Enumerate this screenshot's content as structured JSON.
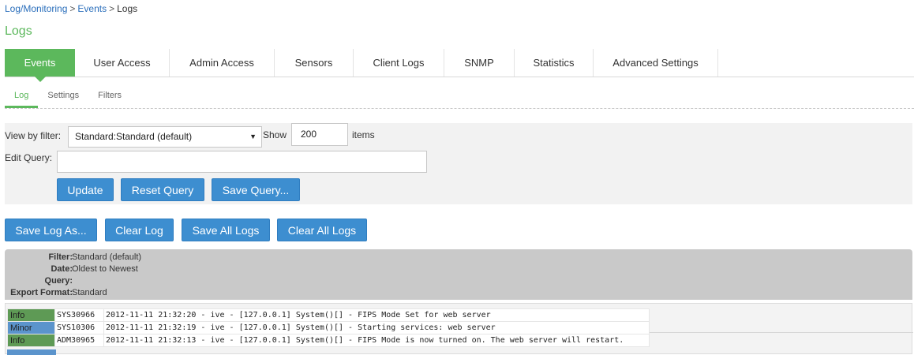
{
  "breadcrumb": {
    "part1": "Log/Monitoring",
    "sep1": ">",
    "part2": "Events",
    "sep2": ">",
    "current": "Logs"
  },
  "page_title": "Logs",
  "tabs": [
    {
      "label": "Events",
      "active": true
    },
    {
      "label": "User Access"
    },
    {
      "label": "Admin Access"
    },
    {
      "label": "Sensors"
    },
    {
      "label": "Client Logs"
    },
    {
      "label": "SNMP"
    },
    {
      "label": "Statistics"
    },
    {
      "label": "Advanced Settings"
    }
  ],
  "subtabs": [
    {
      "label": "Log",
      "active": true
    },
    {
      "label": "Settings"
    },
    {
      "label": "Filters"
    }
  ],
  "filter": {
    "view_label": "View by filter:",
    "selected": "Standard:Standard (default)",
    "show_label": "Show",
    "show_value": "200",
    "items_label": "items",
    "edit_query_label": "Edit Query:",
    "query_value": "",
    "buttons": {
      "update": "Update",
      "reset": "Reset Query",
      "save": "Save Query..."
    }
  },
  "actions": {
    "save_log_as": "Save Log As...",
    "clear_log": "Clear Log",
    "save_all_logs": "Save All Logs",
    "clear_all_logs": "Clear All Logs"
  },
  "summary": {
    "filter_k": "Filter:",
    "filter_v": "Standard (default)",
    "date_k": "Date:",
    "date_v": "Oldest to Newest",
    "query_k": "Query:",
    "query_v": "",
    "export_k": "Export Format:",
    "export_v": "Standard"
  },
  "log_rows": [
    {
      "severity": "Info",
      "code": "SYS30966",
      "message": "2012-11-11 21:32:20 - ive - [127.0.0.1] System()[] - FIPS Mode Set for web server"
    },
    {
      "severity": "Minor",
      "code": "SYS10306",
      "message": "2012-11-11 21:32:19 - ive - [127.0.0.1] System()[] - Starting services: web server"
    },
    {
      "severity": "Info",
      "code": "ADM30965",
      "message": "2012-11-11 21:32:13 - ive - [127.0.0.1] System()[] - FIPS Mode is now turned on. The web server will restart."
    }
  ],
  "colors": {
    "accent_green": "#5cb85c",
    "button_blue": "#3d8ed0",
    "info": "#5e9a55",
    "minor": "#5b94cc"
  }
}
